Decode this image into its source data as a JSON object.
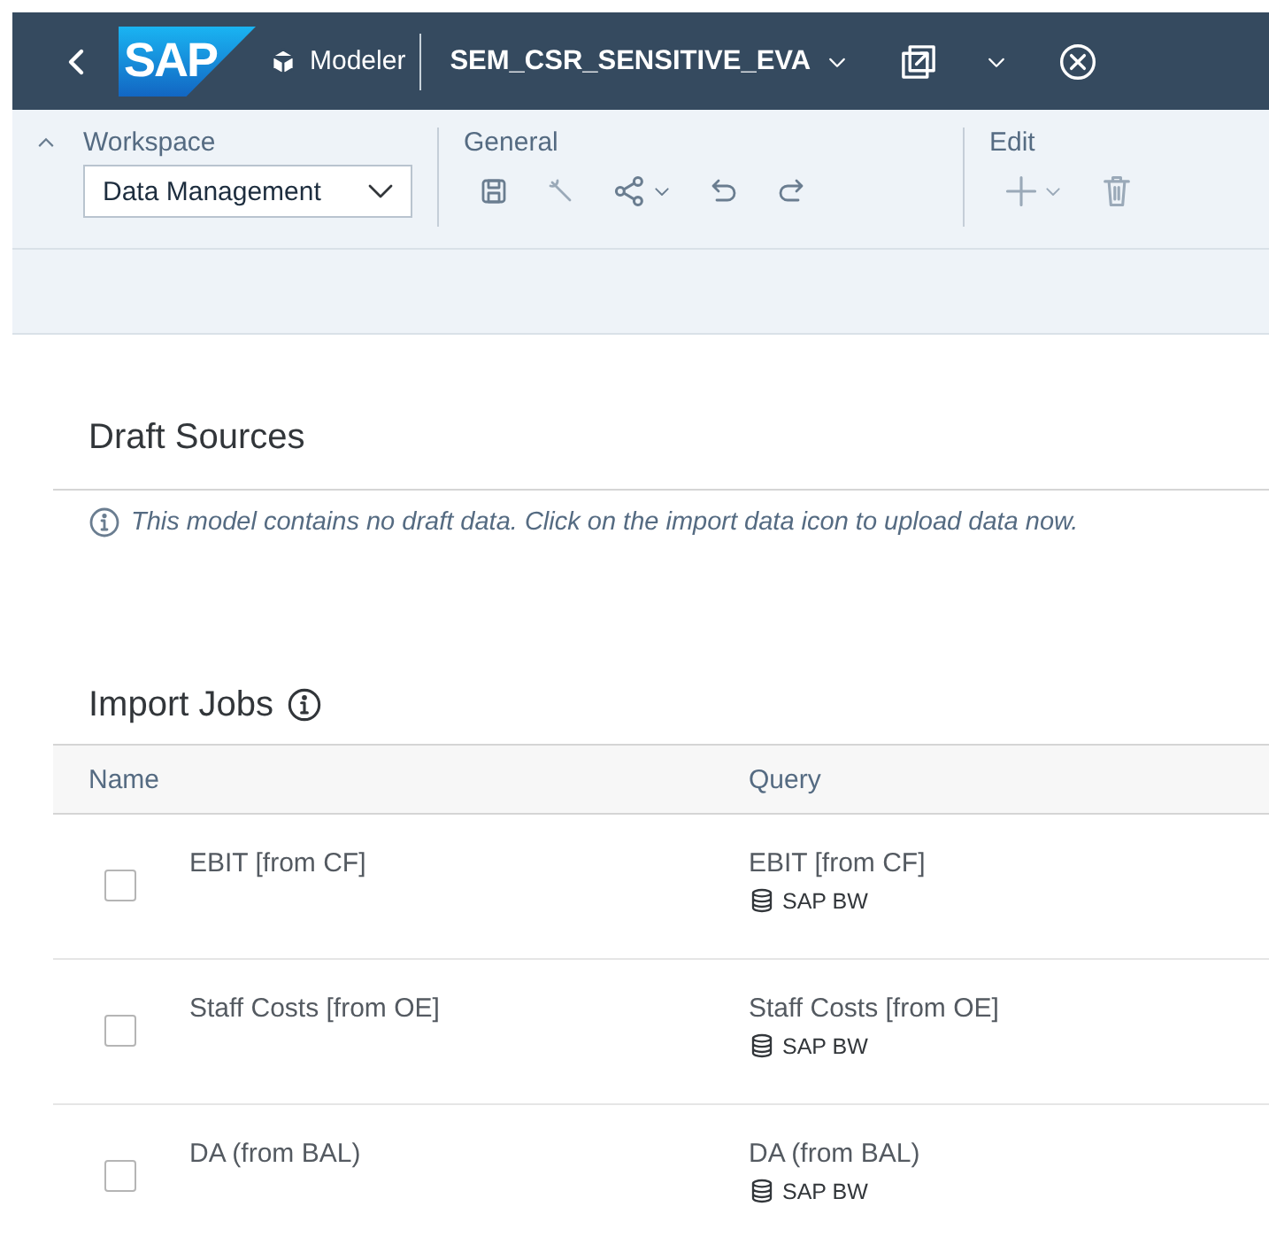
{
  "shell": {
    "logo": "SAP",
    "app": "Modeler",
    "title": "SEM_CSR_SENSITIVE_EVA"
  },
  "toolbar": {
    "collapsed": false,
    "workspace": {
      "label": "Workspace",
      "value": "Data Management"
    },
    "general": {
      "label": "General"
    },
    "edit": {
      "label": "Edit"
    }
  },
  "draft_sources": {
    "title": "Draft Sources",
    "message": "This model contains no draft data. Click on the import data icon to upload data now."
  },
  "import_jobs": {
    "title": "Import Jobs",
    "columns": [
      "Name",
      "Query"
    ],
    "rows": [
      {
        "name": "EBIT [from CF]",
        "query": "EBIT [from CF]",
        "source": "SAP BW",
        "selected": false
      },
      {
        "name": "Staff Costs [from OE]",
        "query": "Staff Costs [from OE]",
        "source": "SAP BW",
        "selected": false
      },
      {
        "name": "DA (from BAL)",
        "query": "DA (from BAL)",
        "source": "SAP BW",
        "selected": false
      }
    ]
  }
}
